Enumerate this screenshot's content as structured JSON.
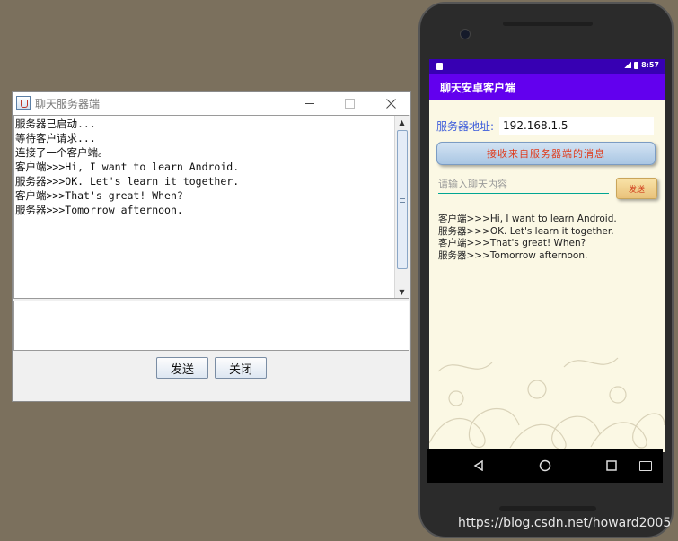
{
  "desktop": {
    "title": "聊天服务器端",
    "log": "服务器已启动...\n等待客户请求...\n连接了一个客户端。\n客户端>>>Hi, I want to learn Android.\n服务器>>>OK. Let's learn it together.\n客户端>>>That's great! When?\n服务器>>>Tomorrow afternoon.",
    "input_value": "",
    "send_label": "发送",
    "close_label": "关闭"
  },
  "phone": {
    "status_time": "8:57",
    "app_title": "聊天安卓客户端",
    "address_label": "服务器地址:",
    "address_value": "192.168.1.5",
    "receive_button": "接收来自服务器端的消息",
    "message_placeholder": "请输入聊天内容",
    "send_label": "发送",
    "log": "客户端>>>Hi, I want to learn Android.\n服务器>>>OK. Let's learn it together.\n客户端>>>That's great! When?\n服务器>>>Tomorrow afternoon."
  },
  "watermark": "https://blog.csdn.net/howard2005",
  "icons": {
    "app": "java-cup-icon",
    "minimize": "minimize-icon",
    "maximize": "maximize-icon",
    "close": "close-icon",
    "back": "back-icon",
    "home": "home-icon",
    "recents": "recents-icon",
    "keyboard": "keyboard-icon"
  },
  "colors": {
    "desktop_bg": "#7b705d",
    "status_bar": "#3700b3",
    "app_bar": "#6200ee",
    "accent_text": "#e03a1a",
    "label_blue": "#3b5bdb"
  }
}
